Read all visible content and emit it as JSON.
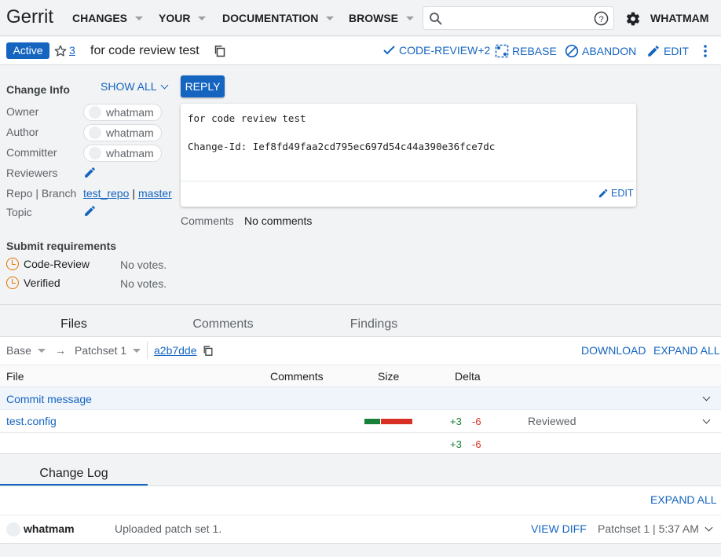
{
  "header": {
    "logo": "Gerrit",
    "nav": [
      {
        "label": "CHANGES"
      },
      {
        "label": "YOUR"
      },
      {
        "label": "DOCUMENTATION"
      },
      {
        "label": "BROWSE"
      }
    ],
    "search_placeholder": "",
    "user": "WHATMAM"
  },
  "change": {
    "status": "Active",
    "star_count": "3",
    "title": "for code review test",
    "actions": {
      "code_review": "CODE-REVIEW+2",
      "rebase": "REBASE",
      "abandon": "ABANDON",
      "edit": "EDIT"
    }
  },
  "info": {
    "heading": "Change Info",
    "show_all": "SHOW ALL",
    "owner_label": "Owner",
    "owner": "whatmam",
    "author_label": "Author",
    "author": "whatmam",
    "committer_label": "Committer",
    "committer": "whatmam",
    "reviewers_label": "Reviewers",
    "repo_branch_label": "Repo | Branch",
    "repo": "test_repo",
    "sep": "|",
    "branch": "master",
    "topic_label": "Topic",
    "submit_heading": "Submit requirements",
    "requirements": [
      {
        "name": "Code-Review",
        "status": "No votes."
      },
      {
        "name": "Verified",
        "status": "No votes."
      }
    ]
  },
  "message": {
    "reply": "REPLY",
    "line1": "for code review test",
    "line2": "Change-Id: Ief8fd49faa2cd795ec697d54c44a390e36fce7dc",
    "edit": "EDIT",
    "comments_label": "Comments",
    "comments_value": "No comments"
  },
  "tabs": [
    "Files",
    "Comments",
    "Findings"
  ],
  "files": {
    "base": "Base",
    "arrow": "→",
    "patchset": "Patchset 1",
    "commit": "a2b7dde",
    "download": "DOWNLOAD",
    "expand_all": "EXPAND ALL",
    "columns": {
      "file": "File",
      "comments": "Comments",
      "size": "Size",
      "delta": "Delta"
    },
    "commit_message": "Commit message",
    "rows": [
      {
        "name": "test.config",
        "added": "+3",
        "removed": "-6",
        "status": "Reviewed"
      }
    ],
    "total_added": "+3",
    "total_removed": "-6"
  },
  "changelog": {
    "tab": "Change Log",
    "expand_all": "EXPAND ALL",
    "entry": {
      "author": "whatmam",
      "message": "Uploaded patch set 1.",
      "view_diff": "VIEW DIFF",
      "patchset_time": "Patchset 1 | 5:37 AM"
    }
  },
  "colors": {
    "accent": "#1565c0",
    "added": "#188038",
    "removed": "#d93025",
    "warning": "#e37400"
  }
}
